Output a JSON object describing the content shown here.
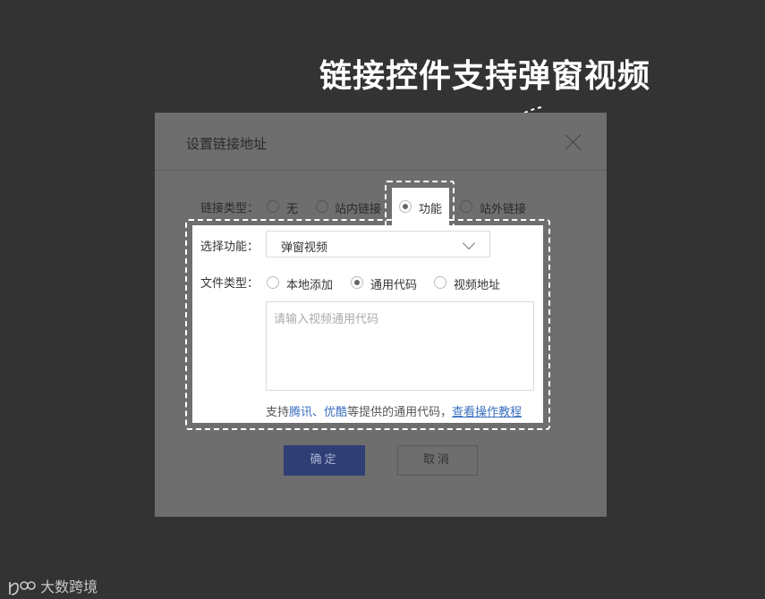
{
  "headline": "链接控件支持弹窗视频",
  "dialog": {
    "title": "设置链接地址",
    "link_type": {
      "label": "链接类型：",
      "options": [
        "无",
        "站内链接",
        "功能",
        "站外链接"
      ],
      "selected": "功能"
    },
    "function": {
      "label": "选择功能：",
      "value": "弹窗视频"
    },
    "file_type": {
      "label": "文件类型：",
      "options": [
        "本地添加",
        "通用代码",
        "视频地址"
      ],
      "selected": "通用代码"
    },
    "code_input": {
      "placeholder": "请输入视频通用代码",
      "value": ""
    },
    "hint": {
      "prefix": "支持",
      "provider1": "腾讯",
      "sep": "、",
      "provider2": "优酷",
      "middle": "等提供的通用代码，",
      "link": "查看操作教程"
    },
    "ok_label": "确定",
    "cancel_label": "取消"
  },
  "brand": {
    "name": "大数跨境"
  },
  "colors": {
    "background": "#333333",
    "dialog": "#6e6e6e",
    "primary": "#2f3e75",
    "link": "#3a6fbf"
  }
}
